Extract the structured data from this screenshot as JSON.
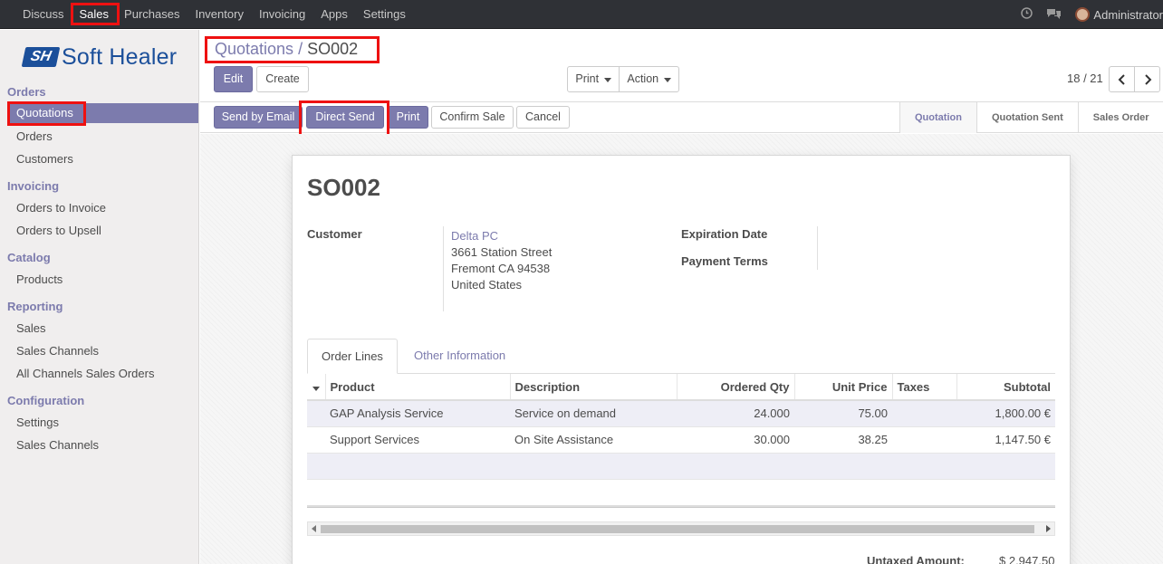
{
  "topnav": {
    "menus": [
      "Discuss",
      "Sales",
      "Purchases",
      "Inventory",
      "Invoicing",
      "Apps",
      "Settings"
    ],
    "active": "Sales",
    "user": "Administrator",
    "icons": [
      "clock-icon",
      "chat-icon"
    ]
  },
  "sidebar": {
    "logo_text": "Soft Healer",
    "logo_mark": "SH",
    "sections": [
      {
        "title": "Orders",
        "items": [
          "Quotations",
          "Orders",
          "Customers"
        ]
      },
      {
        "title": "Invoicing",
        "items": [
          "Orders to Invoice",
          "Orders to Upsell"
        ]
      },
      {
        "title": "Catalog",
        "items": [
          "Products"
        ]
      },
      {
        "title": "Reporting",
        "items": [
          "Sales",
          "Sales Channels",
          "All Channels Sales Orders"
        ]
      },
      {
        "title": "Configuration",
        "items": [
          "Settings",
          "Sales Channels"
        ]
      }
    ],
    "active_item": "Quotations"
  },
  "breadcrumb": {
    "parent": "Quotations",
    "separator": "/",
    "current": "SO002"
  },
  "controls": {
    "edit": "Edit",
    "create": "Create",
    "print": "Print",
    "action": "Action",
    "pager": "18 / 21"
  },
  "statusbar": {
    "buttons": [
      "Send by Email",
      "Direct Send",
      "Print",
      "Confirm Sale",
      "Cancel"
    ],
    "stages": [
      "Quotation",
      "Quotation Sent",
      "Sales Order"
    ],
    "current_stage": "Quotation"
  },
  "form": {
    "title": "SO002",
    "customer_label": "Customer",
    "customer_name": "Delta PC",
    "customer_address": [
      "3661 Station Street",
      "Fremont CA 94538",
      "United States"
    ],
    "expiration_label": "Expiration Date",
    "payment_terms_label": "Payment Terms",
    "tabs": [
      "Order Lines",
      "Other Information"
    ],
    "table": {
      "headers": [
        "Product",
        "Description",
        "Ordered Qty",
        "Unit Price",
        "Taxes",
        "Subtotal"
      ],
      "rows": [
        {
          "product": "GAP Analysis Service",
          "description": "Service on demand",
          "qty": "24.000",
          "price": "75.00",
          "taxes": "",
          "subtotal": "1,800.00 €"
        },
        {
          "product": "Support Services",
          "description": "On Site Assistance",
          "qty": "30.000",
          "price": "38.25",
          "taxes": "",
          "subtotal": "1,147.50 €"
        }
      ]
    },
    "untaxed_label": "Untaxed Amount:",
    "untaxed_value": "$ 2,947.50"
  },
  "colors": {
    "accent": "#7c7bad",
    "topbar": "#2f3136",
    "highlight": "#ee1111"
  }
}
